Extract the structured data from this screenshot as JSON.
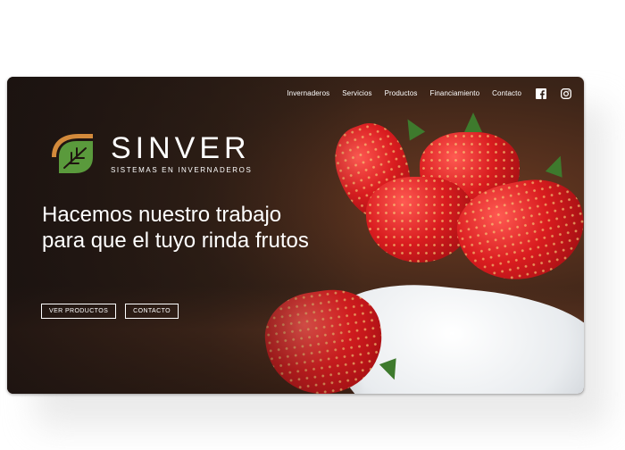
{
  "nav": {
    "items": [
      "Invernaderos",
      "Servicios",
      "Productos",
      "Financiamiento",
      "Contacto"
    ],
    "social": [
      "facebook-icon",
      "instagram-icon"
    ]
  },
  "brand": {
    "name": "SINVER",
    "tagline": "SISTEMAS EN INVERNADEROS",
    "colors": {
      "green": "#5a9a3c",
      "orange": "#d38a3b"
    }
  },
  "hero": {
    "headline": "Hacemos nuestro trabajo para que el tuyo rinda frutos"
  },
  "cta": {
    "primary": "VER PRODUCTOS",
    "secondary": "CONTACTO"
  }
}
